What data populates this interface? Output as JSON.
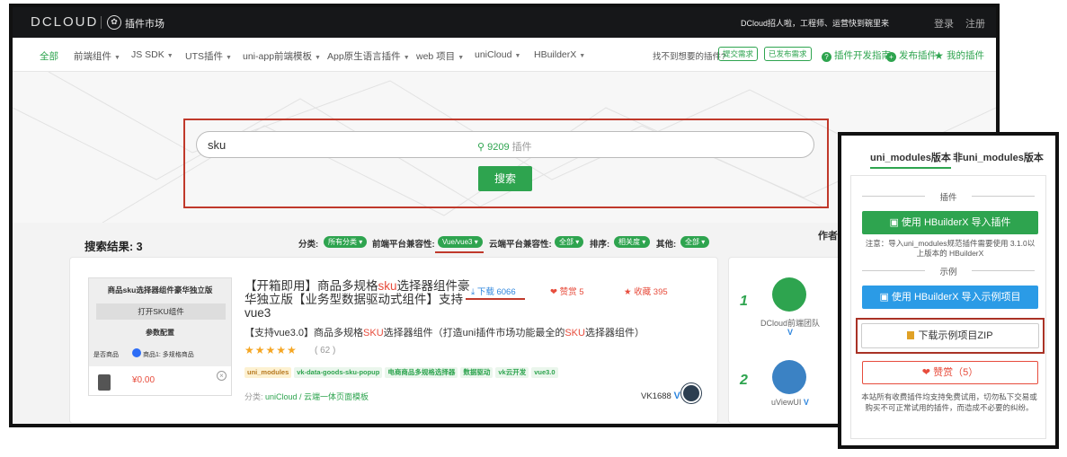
{
  "topbar": {
    "brand": "DCLOUD",
    "market": "插件市场",
    "recruit": "DCloud招人啦，工程师、运营快到碗里来",
    "login": "登录",
    "register": "注册"
  },
  "nav": {
    "items": [
      "全部",
      "前端组件",
      "JS SDK",
      "UTS插件",
      "uni-app前端模板",
      "App原生语言插件",
      "web 项目",
      "uniCloud",
      "HBuilderX"
    ],
    "need_text": "找不到想要的插件?",
    "submit_need": "提交需求",
    "published_need": "已发布需求",
    "dev_guide": "插件开发指南",
    "publish": "发布插件",
    "my_plugins": "我的插件"
  },
  "search": {
    "value": "sku",
    "count": "9209",
    "count_unit": "插件",
    "button": "搜索"
  },
  "results": {
    "title": "搜索结果: 3",
    "filters": {
      "category_label": "分类:",
      "category_value": "所有分类",
      "frontend_label": "前端平台兼容性:",
      "frontend_value": "Vue/vue3",
      "cloud_label": "云端平台兼容性:",
      "cloud_value": "全部",
      "sort_label": "排序:",
      "sort_value": "相关度",
      "other_label": "其他:",
      "other_value": "全部"
    }
  },
  "plugin": {
    "title_pre": "【开箱即用】商品多规格",
    "title_hl": "sku",
    "title_post": "选择器组件豪华独立版【业务型数据驱动式组件】支持vue3",
    "desc_pre": "【支持vue3.0】商品多规格",
    "desc_hl1": "SKU",
    "desc_mid": "选择器组件（打造uni插件市场功能最全的",
    "desc_hl2": "SKU",
    "desc_post": "选择器组件）",
    "stars": "★★★★★",
    "rating": "( 62 )",
    "tags": [
      "uni_modules",
      "vk-data-goods-sku-popup",
      "电商商品多规格选择器",
      "数据驱动",
      "vk云开发",
      "vue3.0"
    ],
    "category_label": "分类:",
    "category": "uniCloud / 云端一体页面模板",
    "downloads": "下载 6066",
    "likes": "赞赏 5",
    "favorites": "收藏 395",
    "author": "VK1688",
    "thumb": {
      "title": "商品sku选择器组件豪华独立版",
      "open_button": "打开SKU组件",
      "config": "参数配置",
      "row_label": "是否商品",
      "option": "商品1: 多规格商品",
      "price": "¥0.00"
    }
  },
  "authors": {
    "heading": "作者",
    "list": [
      {
        "rank": "1",
        "name": "DCloud前端团队",
        "mark": "V"
      },
      {
        "rank": "2",
        "name": "uViewUI",
        "mark": "V"
      }
    ]
  },
  "panel": {
    "tab_uni": "uni_modules版本",
    "tab_non": "非uni_modules版本",
    "plugin_label": "插件",
    "import_plugin": "使用 HBuilderX 导入插件",
    "note": "注意：导入uni_modules规范插件需要使用 3.1.0以上版本的 HBuilderX",
    "example_label": "示例",
    "import_example": "使用 HBuilderX 导入示例项目",
    "download_zip": "下载示例项目ZIP",
    "reward": "赞赏（5）",
    "footnote": "本站所有收费插件均支持免费试用，切勿私下交易或购买不可正常试用的插件，而造成不必要的纠纷。"
  },
  "colors": {
    "accent": "#2ea44f",
    "highlight": "#e74c3c",
    "annotation": "#c0392b",
    "link_blue": "#2e86de"
  }
}
